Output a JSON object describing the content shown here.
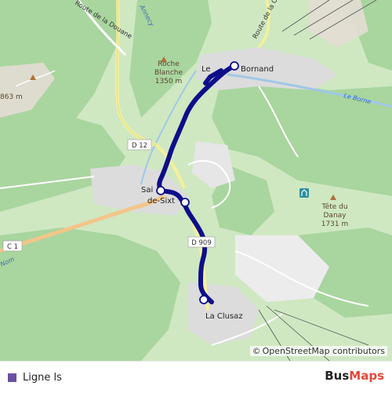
{
  "map": {
    "places": {
      "le_grand_bornand_left": "Le",
      "le_grand_bornand_right": "Bornand",
      "saint_jean_top": "Sai",
      "saint_jean_bottom": "de-Sixt",
      "la_clusaz": "La Clusaz",
      "annecy": "Annecy"
    },
    "peaks": {
      "roche_blanche_name_1": "Roche",
      "roche_blanche_name_2": "Blanche",
      "roche_blanche_elev": "1350 m",
      "tete_du_danay_name_1": "Tête du",
      "tete_du_danay_name_2": "Danay",
      "tete_du_danay_elev": "1731 m",
      "west_peak_elev": "863 m"
    },
    "roads": {
      "d12": "D 12",
      "d909": "D 909",
      "c1": "C 1",
      "route_douane": "Route de la Douane",
      "route_clusaz": "Route de la Clusaz",
      "nom": "Nom"
    },
    "streams": {
      "le_borne": "Le Borne"
    },
    "attribution_symbol": "©",
    "attribution": "OpenStreetMap contributors"
  },
  "legend": {
    "route_name": "Ligne ls",
    "route_color": "#0e0e8a",
    "swatch_color": "#6a4fa3"
  },
  "brand": {
    "part1": "Bus",
    "part2": "Maps"
  },
  "colors": {
    "forest": "#a8d5a0",
    "meadow": "#cfe8c2",
    "urban": "#dddddd",
    "water": "#9fc8e6",
    "route": "#0e0e8a"
  }
}
